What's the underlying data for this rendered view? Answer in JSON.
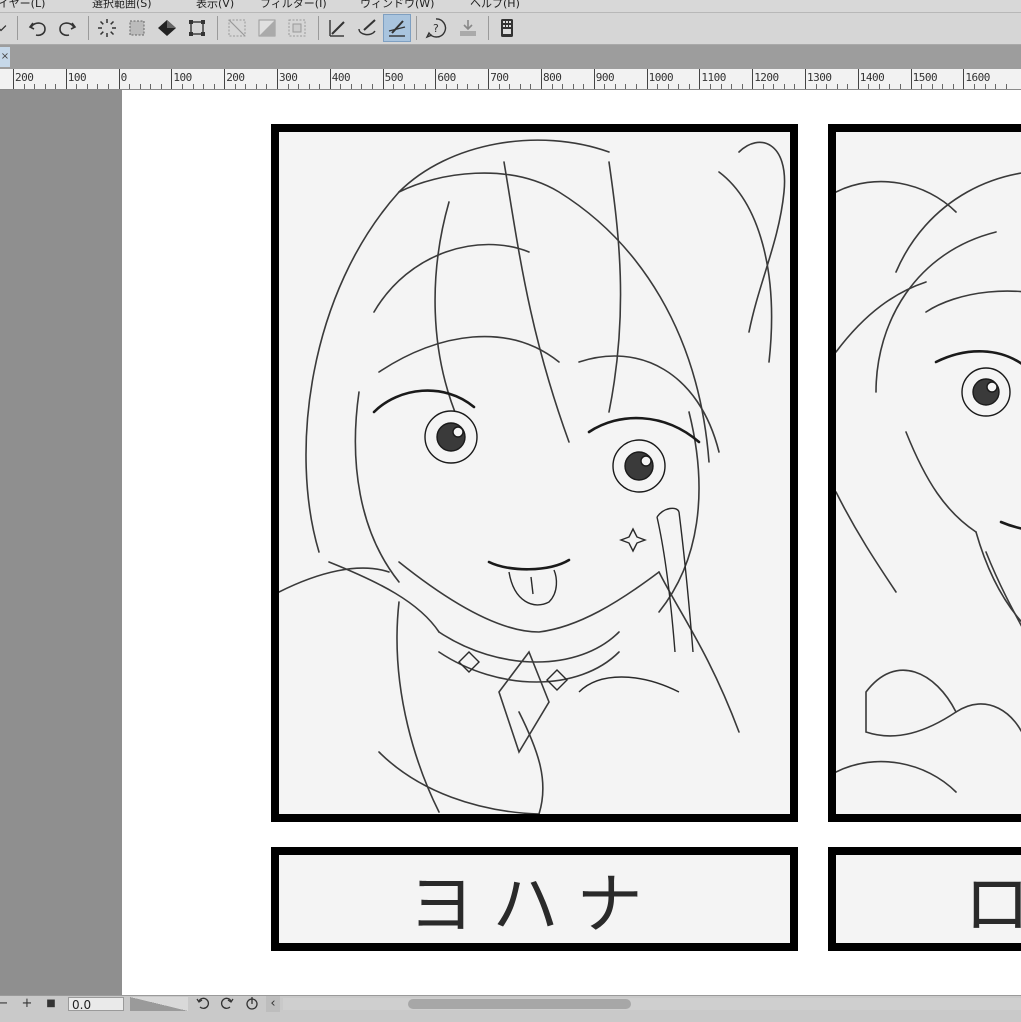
{
  "menu": {
    "items": [
      "イヤー(L)",
      "選択範囲(S)",
      "表示(V)",
      "フィルター(I)",
      "ウィンドウ(W)",
      "ヘルプ(H)"
    ]
  },
  "toolbar": {
    "buttons": [
      {
        "name": "dropdown-toggle",
        "icon": "chevron-down-icon"
      },
      {
        "name": "undo",
        "icon": "undo-icon"
      },
      {
        "name": "redo",
        "icon": "redo-icon"
      },
      {
        "name": "deselect",
        "icon": "deselect-icon"
      },
      {
        "name": "select-area",
        "icon": "selection-icon"
      },
      {
        "name": "fill",
        "icon": "fill-bucket-icon"
      },
      {
        "name": "transform",
        "icon": "transform-icon"
      },
      {
        "name": "clear-outside",
        "icon": "clear-outside-icon"
      },
      {
        "name": "clear-fill",
        "icon": "clear-fill-icon"
      },
      {
        "name": "invert-selection",
        "icon": "invert-selection-icon"
      },
      {
        "name": "ruler-snap",
        "icon": "ruler-snap-icon"
      },
      {
        "name": "brush-snap",
        "icon": "brush-snap-icon"
      },
      {
        "name": "line-snap",
        "icon": "line-snap-icon",
        "active": true
      },
      {
        "name": "help",
        "icon": "help-icon"
      },
      {
        "name": "share",
        "icon": "share-icon"
      },
      {
        "name": "device",
        "icon": "device-icon"
      }
    ]
  },
  "tab": {
    "close_label": "×"
  },
  "ruler": {
    "labels": [
      "200",
      "100",
      "0",
      "100",
      "200",
      "300",
      "400",
      "500",
      "600",
      "700",
      "800",
      "900",
      "1000",
      "1100",
      "1200",
      "1300",
      "1400",
      "1500",
      "1600"
    ]
  },
  "canvas": {
    "panel1_name": "ヨハナ",
    "panel2_name": "ロ"
  },
  "status": {
    "minus": "−",
    "plus": "+",
    "stop": "■",
    "zoom_value": "0.0",
    "scroll_left": "‹"
  },
  "colors": {
    "accent": "#a9c4de",
    "panel_border": "#000000",
    "paper": "#ffffff",
    "workspace": "#8f8f8f"
  }
}
